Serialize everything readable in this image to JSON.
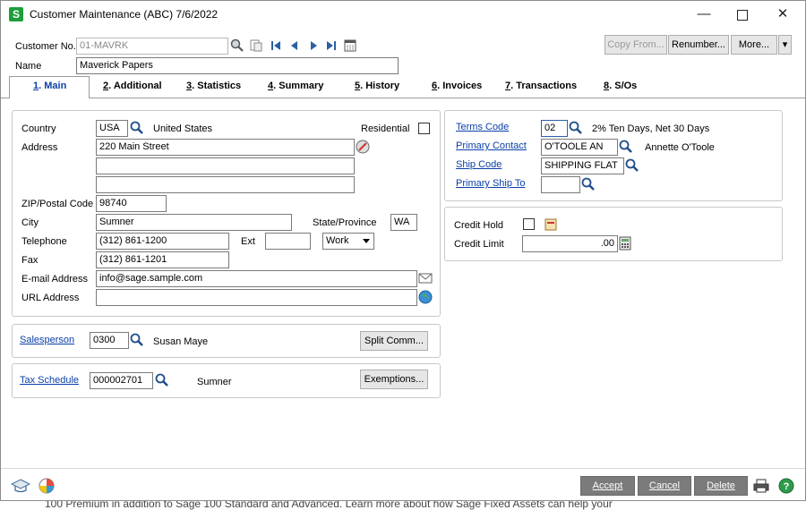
{
  "window": {
    "title": "Customer Maintenance (ABC) 7/6/2022",
    "app_icon": "S"
  },
  "header": {
    "customer_no_label": "Customer No.",
    "customer_no_value": "01-MAVRK",
    "name_label": "Name",
    "name_value": "Maverick Papers",
    "copy_from": "Copy From...",
    "renumber": "Renumber...",
    "more": "More..."
  },
  "tabs": [
    {
      "num": "1",
      "label": ". Main"
    },
    {
      "num": "2",
      "label": ". Additional"
    },
    {
      "num": "3",
      "label": ". Statistics"
    },
    {
      "num": "4",
      "label": ". Summary"
    },
    {
      "num": "5",
      "label": ". History"
    },
    {
      "num": "6",
      "label": ". Invoices"
    },
    {
      "num": "7",
      "label": ". Transactions"
    },
    {
      "num": "8",
      "label": ". S/Os"
    }
  ],
  "address": {
    "country_label": "Country",
    "country_code": "USA",
    "country_name": "United States",
    "residential_label": "Residential",
    "address_label": "Address",
    "address1": "220 Main Street",
    "address2": "",
    "address3": "",
    "zip_label": "ZIP/Postal Code",
    "zip": "98740",
    "city_label": "City",
    "city": "Sumner",
    "state_label": "State/Province",
    "state": "WA",
    "telephone_label": "Telephone",
    "telephone": "(312) 861-1200",
    "ext_label": "Ext",
    "ext": "",
    "phone_type": "Work",
    "fax_label": "Fax",
    "fax": "(312) 861-1201",
    "email_label": "E-mail Address",
    "email": "info@sage.sample.com",
    "url_label": "URL Address",
    "url": ""
  },
  "salesperson": {
    "label": "Salesperson",
    "code": "0300",
    "name": "Susan Maye",
    "split_button": "Split Comm..."
  },
  "tax": {
    "label": "Tax Schedule",
    "code": "000002701",
    "name": "Sumner",
    "exemptions_button": "Exemptions..."
  },
  "terms": {
    "terms_label": "Terms Code",
    "terms_code": "02",
    "terms_desc": "2% Ten Days, Net 30 Days",
    "contact_label": "Primary Contact",
    "contact_code": "O'TOOLE AN",
    "contact_name": "Annette O'Toole",
    "ship_label": "Ship Code",
    "ship_code": "SHIPPING FLAT",
    "primary_ship_label": "Primary Ship To",
    "primary_ship": ""
  },
  "credit": {
    "hold_label": "Credit Hold",
    "limit_label": "Credit Limit",
    "limit_value": ".00"
  },
  "footer": {
    "accept": "Accept",
    "cancel": "Cancel",
    "delete": "Delete"
  },
  "background_text": "100 Premium in addition to Sage 100 Standard and Advanced. Learn more about how Sage Fixed Assets can help your"
}
